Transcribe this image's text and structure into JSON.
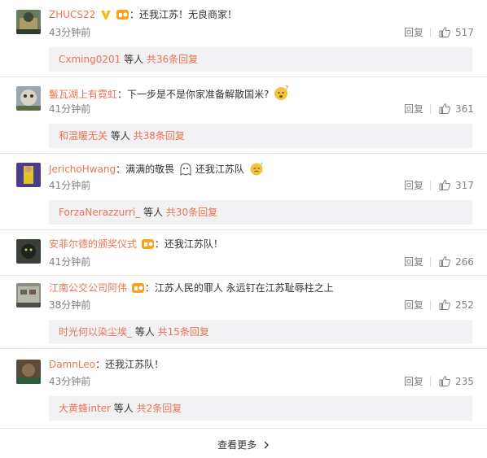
{
  "colors": {
    "username": "#eb7350",
    "meta": "#808080",
    "subbox": "#f2f2f5",
    "badge_gold": "#f5b91b"
  },
  "comments": [
    {
      "user": "ZHUCS22",
      "text": "：还我江苏！无良商家！",
      "time": "43分钟前",
      "reply": "回复",
      "likes": "517",
      "sub_user": "Cxming0201",
      "sub_mid": " 等人 ",
      "sub_count": "共36条回复",
      "icons": [
        "vip-badge-icon",
        "fan-badge-icon"
      ]
    },
    {
      "user": "鬣瓦湖上有霓虹",
      "text": "：下一步是不是你家准备解散国米?",
      "time": "41分钟前",
      "reply": "回复",
      "likes": "361",
      "sub_user": "和温暖无关",
      "sub_mid": " 等人 ",
      "sub_count": "共38条回复",
      "icons": [
        "question-emoji-icon"
      ]
    },
    {
      "user": "JerichoHwang",
      "text": "：满满的敬畏",
      "text2": " 还我江苏队",
      "time": "41分钟前",
      "reply": "回复",
      "likes": "317",
      "sub_user": "ForzaNerazzurri_",
      "sub_mid": " 等人 ",
      "sub_count": "共30条回复",
      "icons": [
        "ghost-emoji-icon",
        "sweat-emoji-icon"
      ]
    },
    {
      "user": "安菲尔德的颁奖仪式",
      "text": "：还我江苏队！",
      "time": "41分钟前",
      "reply": "回复",
      "likes": "266",
      "icons": [
        "fan-badge-icon"
      ]
    },
    {
      "user": "江南公交公司阿伟",
      "text": "：江苏人民的罪人 永远钉在江苏耻辱柱之上",
      "time": "38分钟前",
      "reply": "回复",
      "likes": "252",
      "sub_user": "时光何以染尘埃_",
      "sub_mid": " 等人 ",
      "sub_count": "共15条回复",
      "icons": [
        "fan-badge-icon"
      ]
    },
    {
      "user": "DamnLeo",
      "text": "：还我江苏队！",
      "time": "43分钟前",
      "reply": "回复",
      "likes": "235",
      "sub_user": "大黄蜂inter",
      "sub_mid": " 等人 ",
      "sub_count": "共2条回复",
      "icons": []
    }
  ],
  "see_more": "查看更多"
}
